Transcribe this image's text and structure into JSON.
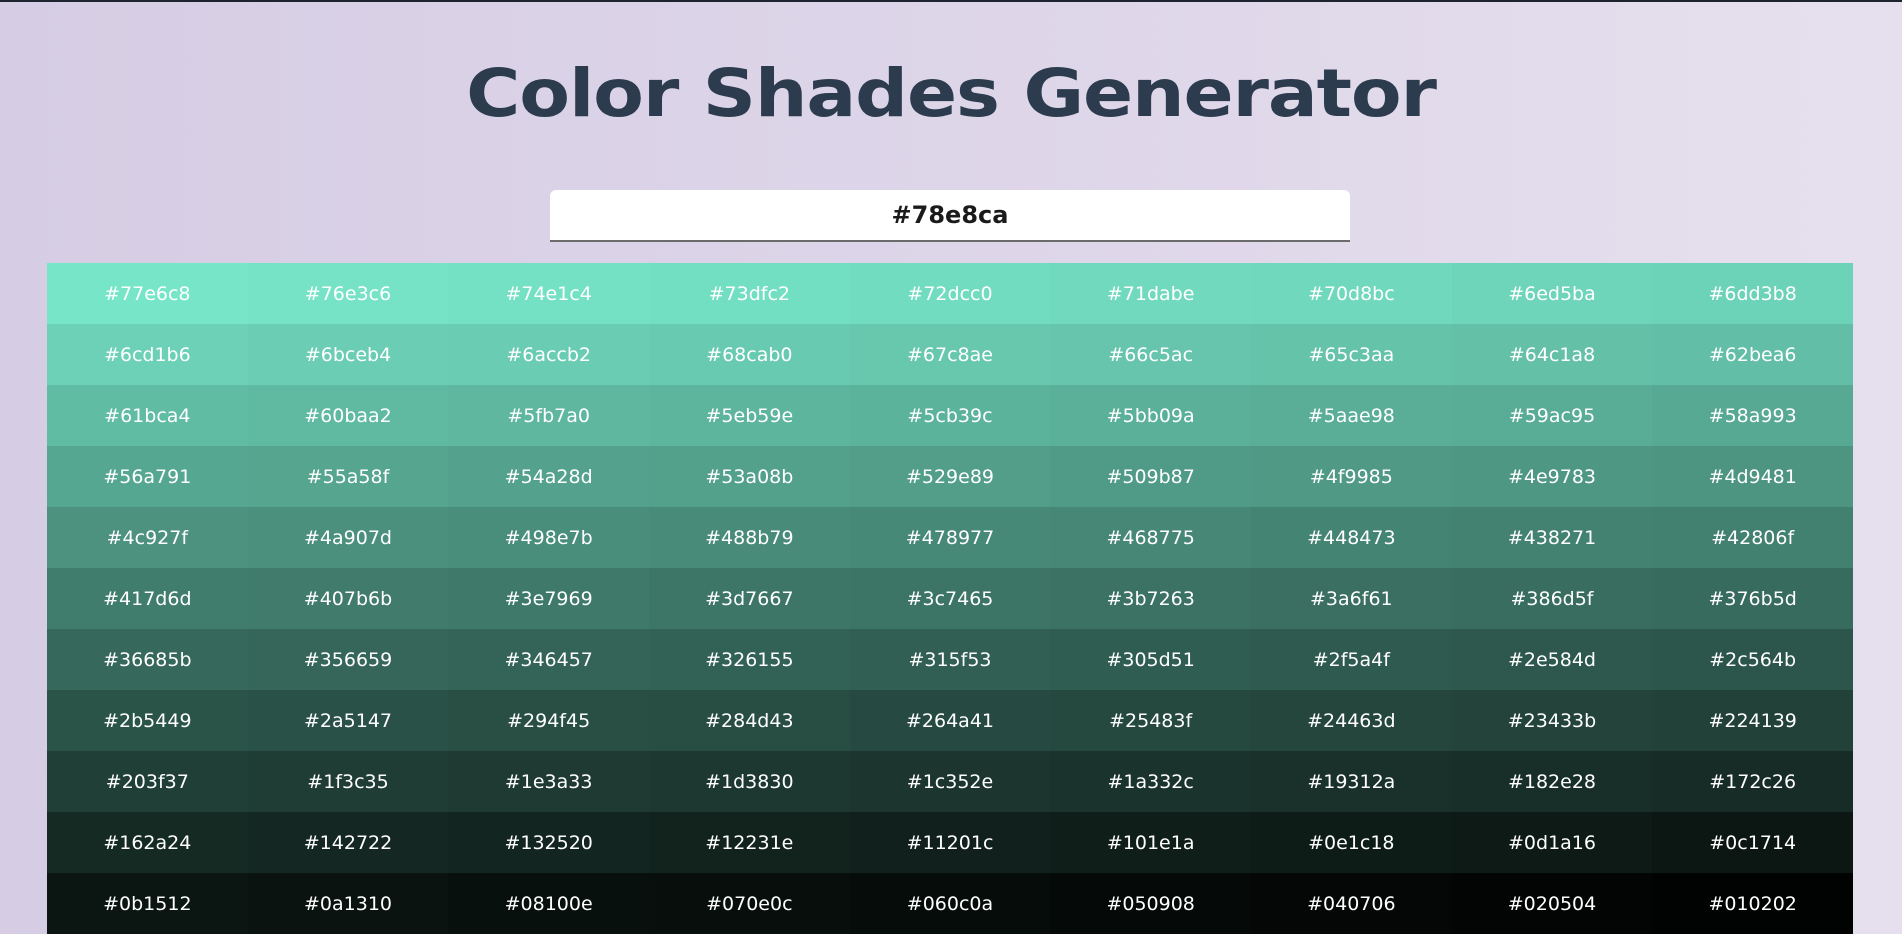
{
  "header": {
    "title": "Color Shades Generator"
  },
  "color_input": {
    "value": "#78e8ca"
  },
  "shades": [
    "#77e6c8",
    "#76e3c6",
    "#74e1c4",
    "#73dfc2",
    "#72dcc0",
    "#71dabe",
    "#70d8bc",
    "#6ed5ba",
    "#6dd3b8",
    "#6cd1b6",
    "#6bceb4",
    "#6accb2",
    "#68cab0",
    "#67c8ae",
    "#66c5ac",
    "#65c3aa",
    "#64c1a8",
    "#62bea6",
    "#61bca4",
    "#60baa2",
    "#5fb7a0",
    "#5eb59e",
    "#5cb39c",
    "#5bb09a",
    "#5aae98",
    "#59ac95",
    "#58a993",
    "#56a791",
    "#55a58f",
    "#54a28d",
    "#53a08b",
    "#529e89",
    "#509b87",
    "#4f9985",
    "#4e9783",
    "#4d9481",
    "#4c927f",
    "#4a907d",
    "#498e7b",
    "#488b79",
    "#478977",
    "#468775",
    "#448473",
    "#438271",
    "#42806f",
    "#417d6d",
    "#407b6b",
    "#3e7969",
    "#3d7667",
    "#3c7465",
    "#3b7263",
    "#3a6f61",
    "#386d5f",
    "#376b5d",
    "#36685b",
    "#356659",
    "#346457",
    "#326155",
    "#315f53",
    "#305d51",
    "#2f5a4f",
    "#2e584d",
    "#2c564b",
    "#2b5449",
    "#2a5147",
    "#294f45",
    "#284d43",
    "#264a41",
    "#25483f",
    "#24463d",
    "#23433b",
    "#224139",
    "#203f37",
    "#1f3c35",
    "#1e3a33",
    "#1d3830",
    "#1c352e",
    "#1a332c",
    "#19312a",
    "#182e28",
    "#172c26",
    "#162a24",
    "#142722",
    "#132520",
    "#12231e",
    "#11201c",
    "#101e1a",
    "#0e1c18",
    "#0d1a16",
    "#0c1714",
    "#0b1512",
    "#0a1310",
    "#08100e",
    "#070e0c",
    "#060c0a",
    "#050908",
    "#040706",
    "#020504",
    "#010202"
  ]
}
